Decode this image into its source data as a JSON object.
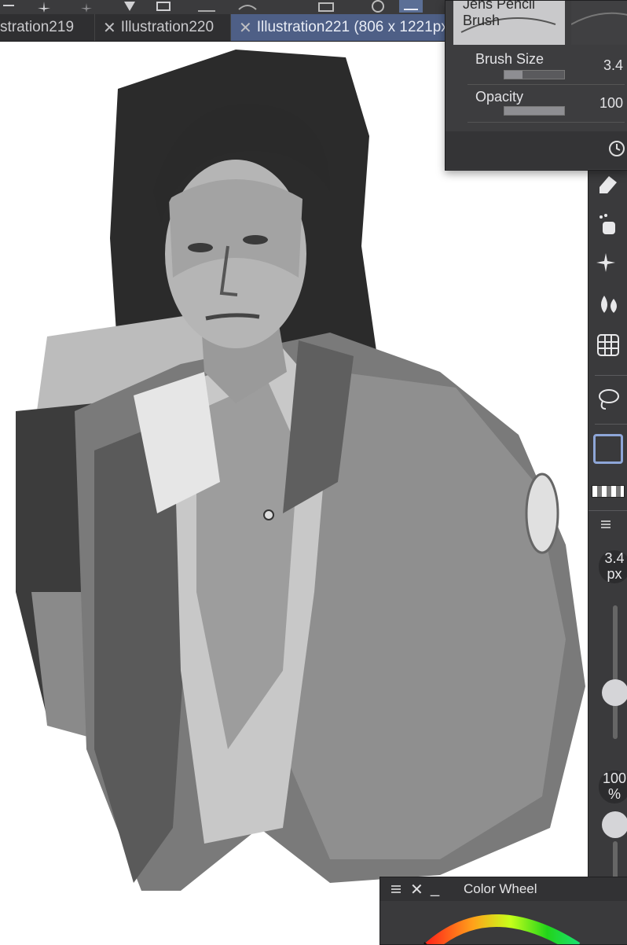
{
  "tabs": [
    {
      "label": "stration219"
    },
    {
      "label": "Illustration220"
    },
    {
      "label": "Illustration221 (806 x 1221px"
    }
  ],
  "brush_panel": {
    "brush_name": "Jens Pencil Brush",
    "brush_size_label": "Brush Size",
    "brush_size_value": "3.4",
    "brush_size_fraction": 0.3,
    "opacity_label": "Opacity",
    "opacity_value": "100",
    "opacity_fraction": 1.0
  },
  "size_slider": {
    "value": "3.4",
    "unit": "px"
  },
  "opacity_slider": {
    "value": "100",
    "unit": "%"
  },
  "color_wheel_panel": {
    "title": "Color Wheel"
  },
  "icons": {
    "toolbar": [
      "transform-icon",
      "sparkle-icon",
      "fill-icon",
      "ruler-icon",
      "selection-icon",
      "active-tool-icon"
    ],
    "rightstrip": [
      "eraser-icon",
      "airbrush-icon",
      "decoration-icon",
      "blend-icon",
      "grid-icon",
      "lasso-icon",
      "color-swatch-icon",
      "transparent-swatch-icon",
      "panel-menu-icon"
    ]
  },
  "colors": {
    "accent": "#5b6f96",
    "panel": "#3a3a3c",
    "current_color": "#3a3a3c"
  }
}
